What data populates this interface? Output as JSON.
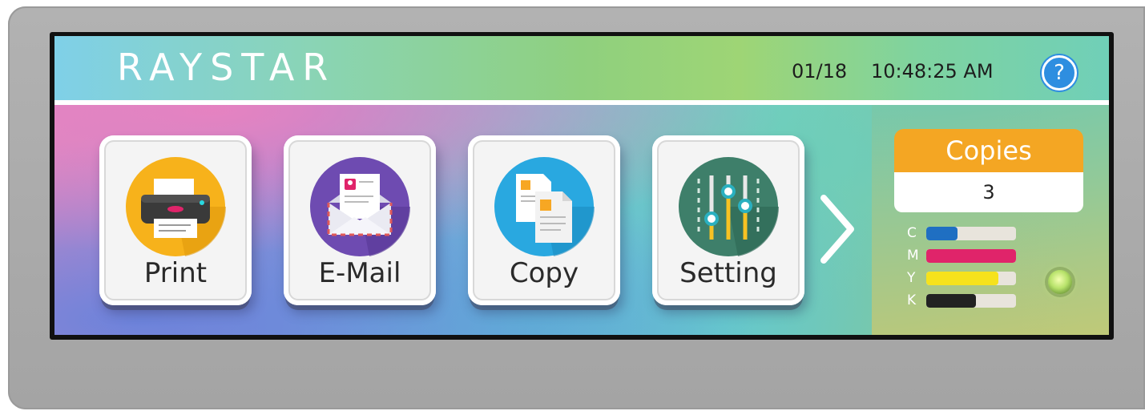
{
  "header": {
    "brand": "RAYSTAR",
    "date": "01/18",
    "time": "10:48:25 AM",
    "help_icon": "question-icon",
    "help_label": "?"
  },
  "tiles": [
    {
      "label": "Print",
      "icon": "printer-icon",
      "color": "#f7b21b"
    },
    {
      "label": "E-Mail",
      "icon": "envelope-icon",
      "color": "#6e4bb1"
    },
    {
      "label": "Copy",
      "icon": "documents-icon",
      "color": "#29a8e0"
    },
    {
      "label": "Setting",
      "icon": "sliders-icon",
      "color": "#3e7f6a"
    }
  ],
  "next_icon": "chevron-right-icon",
  "copies": {
    "title": "Copies",
    "value": "3"
  },
  "ink_levels": [
    {
      "label": "C",
      "level": 0.35,
      "color": "#1f6fc2"
    },
    {
      "label": "M",
      "level": 1.0,
      "color": "#e0246a"
    },
    {
      "label": "Y",
      "level": 0.8,
      "color": "#f6e21c"
    },
    {
      "label": "K",
      "level": 0.55,
      "color": "#222222"
    }
  ],
  "status_led": {
    "icon": "status-led-icon",
    "color": "#b7e26a"
  }
}
